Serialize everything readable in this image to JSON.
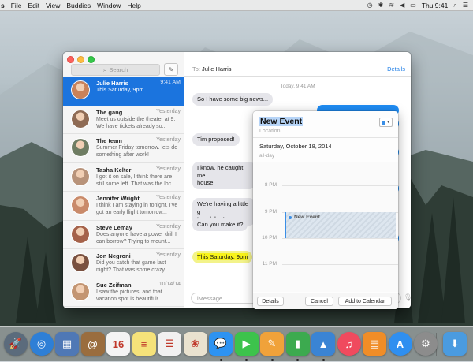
{
  "menubar": {
    "app_fragment": "s",
    "menus": [
      "File",
      "Edit",
      "View",
      "Buddies",
      "Window",
      "Help"
    ],
    "clock": "Thu 9:41"
  },
  "sidebar": {
    "search_placeholder": "Search",
    "conversations": [
      {
        "name": "Julie Harris",
        "time": "9:41 AM",
        "preview": "This Saturday, 9pm",
        "active": true,
        "avatar_color": "#c9825a"
      },
      {
        "name": "The gang",
        "time": "Yesterday",
        "preview": "Meet us outside the theater at 9. We have tickets already so...",
        "active": false,
        "avatar_color": "#8f6b55"
      },
      {
        "name": "The team",
        "time": "Yesterday",
        "preview": "Summer Friday tomorrow. lets do something after work!",
        "active": false,
        "avatar_color": "#6f7d63"
      },
      {
        "name": "Tasha Kelter",
        "time": "Yesterday",
        "preview": "I got it on sale, I think there are still some left. That was the loc...",
        "active": false,
        "avatar_color": "#b8937a"
      },
      {
        "name": "Jennifer Wright",
        "time": "Yesterday",
        "preview": "I think I am staying in tonight. I've got an early flight tomorrow...",
        "active": false,
        "avatar_color": "#c98a6a"
      },
      {
        "name": "Steve Lemay",
        "time": "Yesterday",
        "preview": "Does anyone have a power drill I can borrow? Trying to mount...",
        "active": false,
        "avatar_color": "#a5624a"
      },
      {
        "name": "Jon Negroni",
        "time": "Yesterday",
        "preview": "Did you catch that game last night? That was some crazy...",
        "active": false,
        "avatar_color": "#7a5140"
      },
      {
        "name": "Sue Zeifman",
        "time": "10/14/14",
        "preview": "I saw the pictures, and that vacation spot is beautiful!",
        "active": false,
        "avatar_color": "#c39572"
      }
    ]
  },
  "chat": {
    "to_label": "To:",
    "to_name": "Julie Harris",
    "details_label": "Details",
    "date_stamp": "Today, 9:41 AM",
    "messages": {
      "m1": "So I have some big news...",
      "m2": "Tim proposed!",
      "m3": "I know, he caught me",
      "m3b": "house.",
      "m4": "We're having a little g",
      "m4b": "to celebrate.",
      "m5": "Can you make it?",
      "m6": "This Saturday, 9pm"
    },
    "composer_placeholder": "iMessage"
  },
  "event_popover": {
    "title": "New Event",
    "location_placeholder": "Location",
    "date": "Saturday, October 18, 2014",
    "all_day": "all-day",
    "hours": [
      "8 PM",
      "9 PM",
      "10 PM",
      "11 PM"
    ],
    "event_label": "New Event",
    "calendar_color": "#3a8ee6",
    "buttons": {
      "details": "Details",
      "cancel": "Cancel",
      "add": "Add to Calendar"
    }
  },
  "dock": {
    "apps": [
      {
        "name": "launchpad",
        "color": "#5b6b7c",
        "glyph": "🚀"
      },
      {
        "name": "safari",
        "color": "#2e7fd6",
        "glyph": "◎"
      },
      {
        "name": "preview",
        "color": "#4f78b5",
        "glyph": "▦"
      },
      {
        "name": "contacts",
        "color": "#9a6d3e",
        "glyph": "@"
      },
      {
        "name": "calendar",
        "color": "#f4f4f4",
        "glyph": "16"
      },
      {
        "name": "notes",
        "color": "#f5e27a",
        "glyph": "≡"
      },
      {
        "name": "reminders",
        "color": "#f1f1f1",
        "glyph": "☰"
      },
      {
        "name": "photos",
        "color": "#e9e2cf",
        "glyph": "❀"
      },
      {
        "name": "messages",
        "color": "#2d93f2",
        "glyph": "💬"
      },
      {
        "name": "facetime",
        "color": "#3dc34c",
        "glyph": "▶"
      },
      {
        "name": "pages",
        "color": "#f0a23a",
        "glyph": "✎"
      },
      {
        "name": "numbers",
        "color": "#3caa4f",
        "glyph": "▮"
      },
      {
        "name": "keynote",
        "color": "#3a84d4",
        "glyph": "▲"
      },
      {
        "name": "itunes",
        "color": "#f04a5e",
        "glyph": "♫"
      },
      {
        "name": "ibooks",
        "color": "#f08d27",
        "glyph": "▤"
      },
      {
        "name": "app-store",
        "color": "#2f8ff0",
        "glyph": "A"
      },
      {
        "name": "system-preferences",
        "color": "#8c8c8c",
        "glyph": "⚙"
      },
      {
        "name": "downloads",
        "color": "#4a9be0",
        "glyph": "⬇"
      }
    ]
  }
}
